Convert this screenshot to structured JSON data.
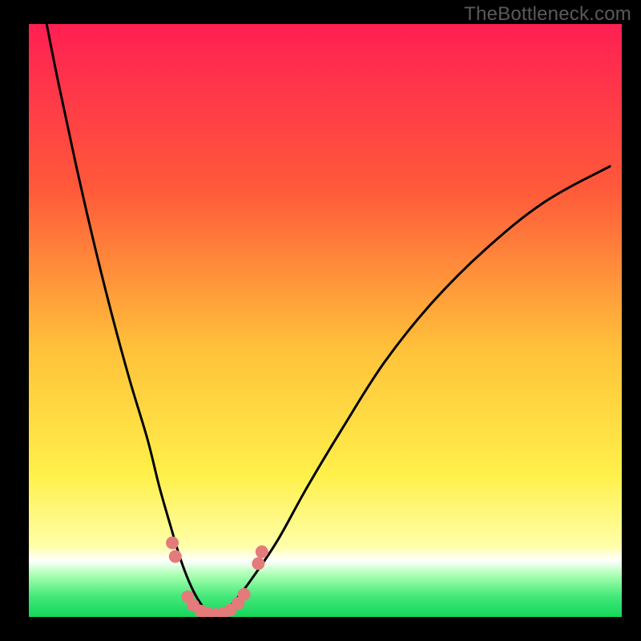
{
  "watermark": "TheBottleneck.com",
  "chart_data": {
    "type": "line",
    "title": "",
    "xlabel": "",
    "ylabel": "",
    "xlim": [
      0,
      100
    ],
    "ylim": [
      0,
      100
    ],
    "grid": false,
    "background_gradient_stops": [
      {
        "offset": 0,
        "color": "#ff1f53"
      },
      {
        "offset": 0.28,
        "color": "#ff5a3a"
      },
      {
        "offset": 0.55,
        "color": "#ffc23a"
      },
      {
        "offset": 0.76,
        "color": "#fff04a"
      },
      {
        "offset": 0.88,
        "color": "#ffffa8"
      },
      {
        "offset": 0.905,
        "color": "#ffffff"
      },
      {
        "offset": 0.93,
        "color": "#a8ffb0"
      },
      {
        "offset": 0.965,
        "color": "#44e87a"
      },
      {
        "offset": 1.0,
        "color": "#14d65a"
      }
    ],
    "series": [
      {
        "name": "bottleneck-curve",
        "stroke": "#000000",
        "stroke_width": 3,
        "x": [
          3,
          5,
          8,
          11,
          14,
          17,
          20,
          22,
          24,
          25.5,
          27,
          28.5,
          30,
          31.5,
          33,
          35,
          38,
          42,
          47,
          53,
          60,
          68,
          77,
          87,
          98
        ],
        "values": [
          100,
          90,
          76,
          63,
          51,
          40,
          30,
          22,
          15,
          10,
          6,
          3,
          1,
          0,
          1,
          3,
          7,
          13,
          22,
          32,
          43,
          53,
          62,
          70,
          76
        ]
      }
    ],
    "markers": {
      "name": "highlight-dots",
      "color": "#e37b7b",
      "radius_px": 8,
      "points": [
        {
          "x": 24.2,
          "y": 12.5
        },
        {
          "x": 24.7,
          "y": 10.2
        },
        {
          "x": 26.8,
          "y": 3.4
        },
        {
          "x": 27.7,
          "y": 2.0
        },
        {
          "x": 29.0,
          "y": 1.0
        },
        {
          "x": 30.2,
          "y": 0.6
        },
        {
          "x": 31.5,
          "y": 0.4
        },
        {
          "x": 32.8,
          "y": 0.6
        },
        {
          "x": 34.0,
          "y": 1.2
        },
        {
          "x": 35.3,
          "y": 2.3
        },
        {
          "x": 36.3,
          "y": 3.8
        },
        {
          "x": 38.7,
          "y": 9.0
        },
        {
          "x": 39.3,
          "y": 11.0
        }
      ]
    }
  }
}
